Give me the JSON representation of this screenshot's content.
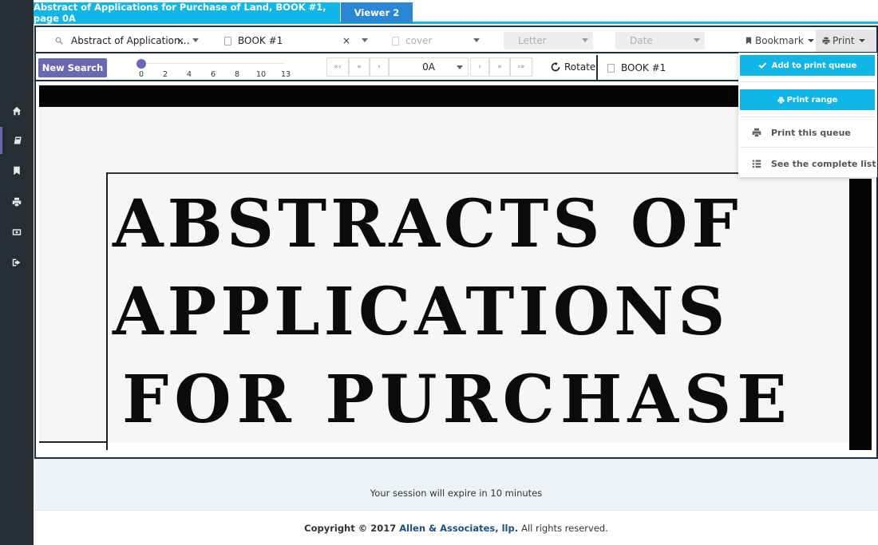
{
  "tabs": [
    {
      "label": "Abstract of Applications for Purchase of Land, BOOK #1, page 0A"
    },
    {
      "label": "Viewer 2"
    }
  ],
  "sidebar": {
    "items": [
      {
        "icon": "home-icon"
      },
      {
        "icon": "book-icon",
        "active": true
      },
      {
        "icon": "bookmark-icon"
      },
      {
        "icon": "print-icon"
      },
      {
        "icon": "money-icon"
      },
      {
        "icon": "sign-out-icon"
      }
    ]
  },
  "filters": {
    "collection": {
      "value": "Abstract of Application…",
      "clear": "×",
      "icon": "search-icon"
    },
    "book": {
      "value": "BOOK #1",
      "clear": "×"
    },
    "section": {
      "placeholder": "cover"
    },
    "letter": {
      "placeholder": "Letter"
    },
    "date": {
      "placeholder": "Date"
    }
  },
  "bookmark_button": {
    "label": "Bookmark",
    "icon": "bookmark-icon"
  },
  "print_button": {
    "label": "Print",
    "icon": "print-icon"
  },
  "navbar": {
    "new_search": "New Search",
    "slider_ticks": [
      "0",
      "2",
      "4",
      "6",
      "8",
      "10",
      "13"
    ],
    "slider_value": 0,
    "pager": {
      "first": "«‹",
      "prev_fast": "«",
      "prev": "‹",
      "next": "›",
      "next_fast": "»",
      "last": "›»"
    },
    "page_value": "0A",
    "rotate": "Rotate",
    "book_label": "BOOK #1"
  },
  "document": {
    "lines": [
      "ABSTRACTS OF",
      "APPLICATIONS",
      "FOR PURCHASE"
    ]
  },
  "print_menu": {
    "add_to_queue": "Add to print queue",
    "print_range": "Print range",
    "print_queue": "Print this queue",
    "see_list": "See the complete list"
  },
  "footer": {
    "session": "Your session will expire in 10 minutes",
    "copyright_prefix": "Copyright © 2017",
    "company": "Allen & Associates, llp.",
    "rights": "All rights reserved."
  },
  "colors": {
    "accent": "#11b6e7",
    "tab2": "#2b86d3",
    "purple": "#6a67b3",
    "sidebar": "#262d33"
  }
}
